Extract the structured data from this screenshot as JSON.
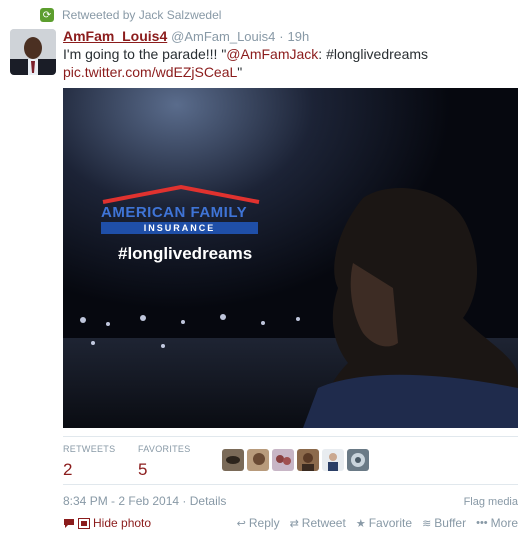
{
  "retweet_banner": {
    "text": "Retweeted by Jack Salzwedel",
    "icon": "retweet-icon"
  },
  "tweet": {
    "display_name": "AmFam_Louis4",
    "handle": "@AmFam_Louis4",
    "separator": "·",
    "time_ago": "19h",
    "text_main": "I'm going to the parade!!! \"",
    "text_mention": "@AmFamJack",
    "text_middle": ": #longlivedreams ",
    "text_link": "pic.twitter.com/wdEZjSCeaL",
    "text_end": "\"",
    "media": {
      "brand_line1": "AMERICAN FAMILY",
      "brand_line2": "INSURANCE",
      "hashtag": "#longlivedreams"
    }
  },
  "stats": {
    "retweets_label": "RETWEETS",
    "retweets_value": "2",
    "favorites_label": "FAVORITES",
    "favorites_value": "5"
  },
  "meta": {
    "timestamp": "8:34 PM - 2 Feb 2014",
    "dot": " · ",
    "details": "Details",
    "flag": "Flag media",
    "hide_photo": "Hide photo"
  },
  "actions": {
    "reply": "Reply",
    "retweet": "Retweet",
    "favorite": "Favorite",
    "buffer": "Buffer",
    "more": "More"
  },
  "colors": {
    "link": "#8b1c1c",
    "muted": "#8899a6",
    "retweet_green": "#5c9e2e",
    "brand_blue": "#1f4fa8",
    "brand_red": "#e0322f"
  }
}
